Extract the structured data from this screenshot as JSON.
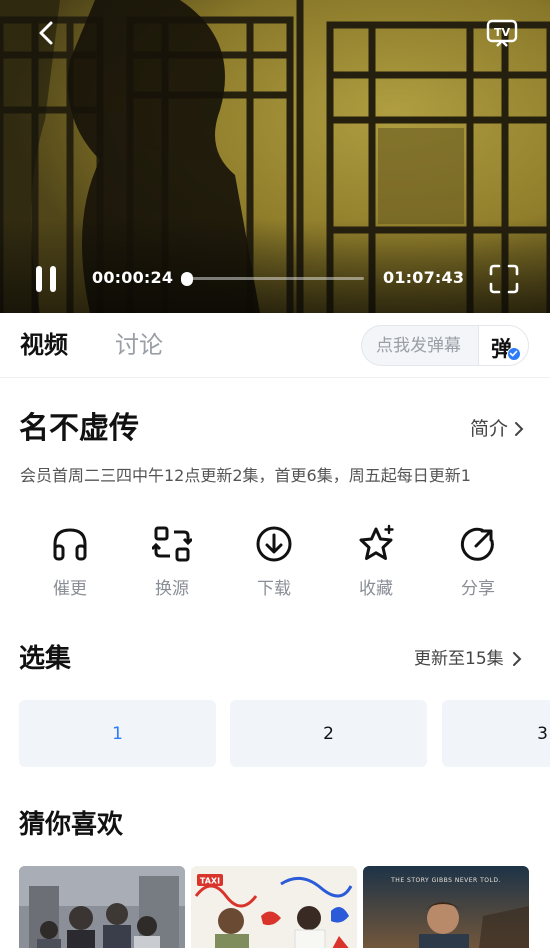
{
  "player": {
    "current_time": "00:00:24",
    "total_time": "01:07:43",
    "progress": 0.006,
    "icons": {
      "back": "chevron-left-icon",
      "tv": "tv-cast-icon",
      "play_pause": "pause-icon",
      "fullscreen": "fullscreen-icon"
    }
  },
  "tabs": [
    {
      "label": "视频",
      "active": true
    },
    {
      "label": "讨论",
      "active": false
    }
  ],
  "danmaku": {
    "placeholder": "点我发弹幕",
    "toggle_label": "弹",
    "toggle_on": true
  },
  "show": {
    "title": "名不虚传",
    "intro_label": "简介",
    "update_notice": "会员首周二三四中午12点更新2集，首更6集，周五起每日更新1"
  },
  "actions": [
    {
      "label": "催更",
      "icon": "headphones-icon"
    },
    {
      "label": "换源",
      "icon": "switch-source-icon"
    },
    {
      "label": "下载",
      "icon": "download-icon"
    },
    {
      "label": "收藏",
      "icon": "star-icon"
    },
    {
      "label": "分享",
      "icon": "share-icon"
    }
  ],
  "episodes": {
    "title": "选集",
    "update_label": "更新至15集",
    "items": [
      {
        "label": "1",
        "active": true
      },
      {
        "label": "2",
        "active": false
      },
      {
        "label": "3",
        "active": false
      }
    ]
  },
  "recommend": {
    "title": "猜你喜欢",
    "items": [
      {
        "poster_text": ""
      },
      {
        "poster_text": "TAXI"
      },
      {
        "poster_text": "THE STORY GIBBS NEVER TOLD."
      }
    ]
  },
  "colors": {
    "accent": "#2b7cf6",
    "tab_inactive": "#9a9ea6",
    "chip_bg": "#f1f4f8"
  }
}
